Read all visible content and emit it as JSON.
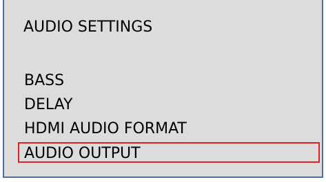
{
  "menu": {
    "title": "AUDIO SETTINGS",
    "items": [
      {
        "label": "BASS",
        "selected": false
      },
      {
        "label": "DELAY",
        "selected": false
      },
      {
        "label": "HDMI AUDIO FORMAT",
        "selected": false
      },
      {
        "label": "AUDIO OUTPUT",
        "selected": true
      }
    ],
    "selection_color": "#e02020",
    "panel_color": "#dcdcdc",
    "border_color": "#4a6da7"
  }
}
